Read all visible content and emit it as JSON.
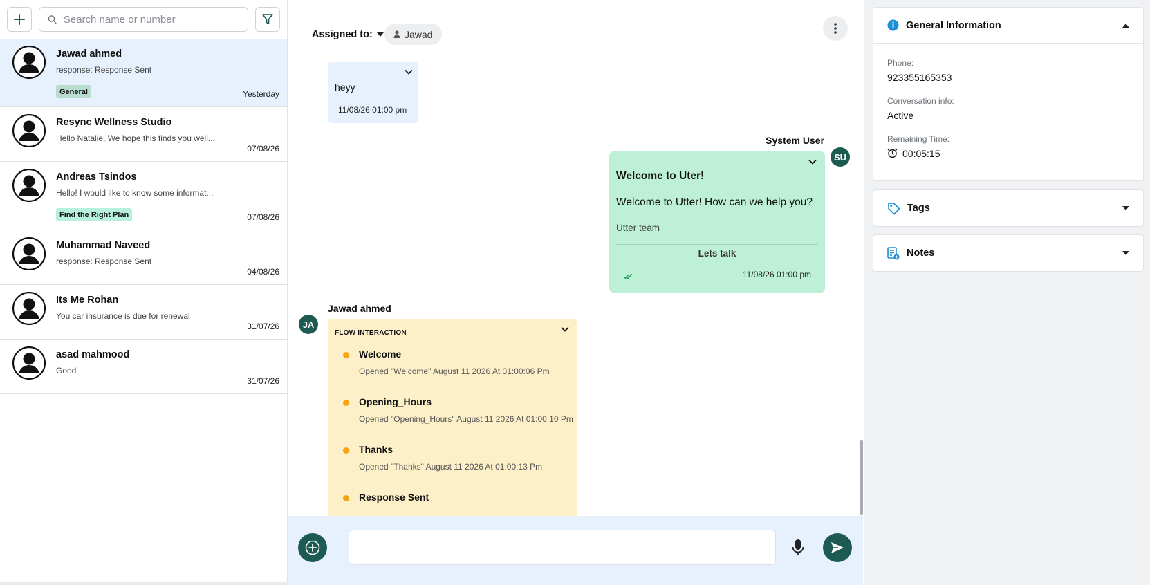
{
  "sidebar": {
    "search_placeholder": "Search name or number",
    "conversations": [
      {
        "name": "Jawad ahmed",
        "preview": "response: Response Sent",
        "tag": "General",
        "date": "Yesterday",
        "active": true
      },
      {
        "name": "Resync Wellness Studio",
        "preview": "Hello Natalie, We hope this finds you well...",
        "tag": "",
        "date": "07/08/26"
      },
      {
        "name": "Andreas Tsindos",
        "preview": "Hello! I would like to know some informat...",
        "tag": "Find the Right Plan",
        "date": "07/08/26"
      },
      {
        "name": "Muhammad Naveed",
        "preview": "response: Response Sent",
        "tag": "",
        "date": "04/08/26"
      },
      {
        "name": "Its Me Rohan",
        "preview": "You car insurance is due for renewal",
        "tag": "",
        "date": "31/07/26"
      },
      {
        "name": "asad mahmood",
        "preview": "Good",
        "tag": "",
        "date": "31/07/26"
      }
    ],
    "tag_colors": {
      "General": "#b9dccf",
      "Find the Right Plan": "#b7f0dd"
    }
  },
  "chat": {
    "assigned_label": "Assigned to:",
    "assignee": "Jawad",
    "messages": {
      "incoming_text": "heyy",
      "incoming_time": "11/08/26 01:00 pm",
      "system_sender": "System User",
      "system_initials": "SU",
      "template_title": "Welcome to Uter!",
      "template_body": "Welcome to Utter! How can we help you?",
      "template_footer": "Utter team",
      "template_button": "Lets talk",
      "template_time": "11/08/26 01:00 pm",
      "contact_sender": "Jawad ahmed",
      "contact_initials": "JA"
    },
    "flow": {
      "title": "FLOW INTERACTION",
      "steps": [
        {
          "name": "Welcome",
          "detail": "Opened \"Welcome\" August 11 2026 At 01:00:06 Pm"
        },
        {
          "name": "Opening_Hours",
          "detail": "Opened \"Opening_Hours\" August 11 2026 At 01:00:10 Pm"
        },
        {
          "name": "Thanks",
          "detail": "Opened \"Thanks\" August 11 2026 At 01:00:13 Pm"
        },
        {
          "name": "Response Sent",
          "detail": ""
        }
      ]
    },
    "composer": {
      "placeholder": ""
    }
  },
  "details": {
    "general_title": "General Information",
    "phone_label": "Phone:",
    "phone": "923355165353",
    "conversation_label": "Conversation info:",
    "conversation_status": "Active",
    "remaining_label": "Remaining Time:",
    "remaining_time": "00:05:15",
    "tags_title": "Tags",
    "notes_title": "Notes"
  },
  "colors": {
    "brand": "#1c5a52",
    "active_row": "#e7f1fd",
    "outgoing_bubble": "#bdf0d6",
    "flow_bubble": "#fdf0c9",
    "flow_dot": "#f2a413",
    "info_icon": "#1a8fd6"
  }
}
